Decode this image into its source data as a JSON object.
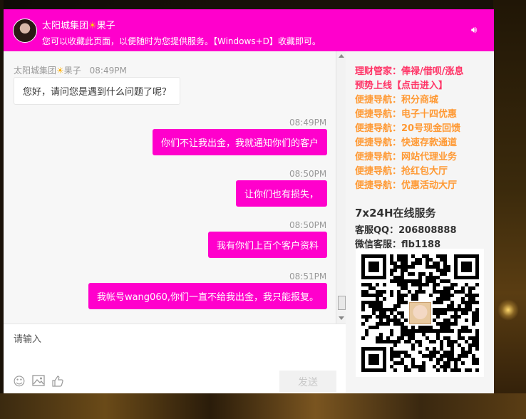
{
  "header": {
    "title_prefix": "太阳城集团",
    "title_suffix": "果子",
    "subtitle": "您可以收藏此页面，以便随时为您提供服务。【Windows+D】收藏即可。"
  },
  "messages": [
    {
      "side": "left",
      "sender_prefix": "太阳城集团",
      "sender_suffix": "果子",
      "time": "08:49PM",
      "text": "您好，请问您是遇到什么问题了呢？"
    },
    {
      "side": "right",
      "time": "08:49PM",
      "text": "你们不让我出金，我就通知你们的客户"
    },
    {
      "side": "right",
      "time": "08:50PM",
      "text": "让你们也有损失，"
    },
    {
      "side": "right",
      "time": "08:50PM",
      "text": "我有你们上百个客户资料"
    },
    {
      "side": "right",
      "time": "08:51PM",
      "text": "我帐号wang060,你们一直不给我出金，我只能报复。"
    }
  ],
  "input": {
    "placeholder": "请输入"
  },
  "toolbar": {
    "send_label": "发送"
  },
  "side": {
    "links": [
      {
        "text": "理财管家：俸禄/借呗/涨息",
        "color": "#ff3366"
      },
      {
        "text": "预势上线【点击进入】",
        "color": "#ff3366"
      },
      {
        "text": "便捷导航：积分商城",
        "color": "#ff9933"
      },
      {
        "text": "便捷导航：电子十四优惠",
        "color": "#ff9933"
      },
      {
        "text": "便捷导航：20号现金回馈",
        "color": "#ff9933"
      },
      {
        "text": "便捷导航：快速存款通道",
        "color": "#ff9933"
      },
      {
        "text": "便捷导航：网站代理业务",
        "color": "#ff9933"
      },
      {
        "text": "便捷导航：抢红包大厅",
        "color": "#ff9933"
      },
      {
        "text": "便捷导航：优惠活动大厅",
        "color": "#ff9933"
      }
    ],
    "service_title": "7x24H在线服务",
    "qq": "客服QQ：206808888",
    "wechat": "微信客服：flb1188"
  },
  "colors": {
    "accent": "#ff00cc"
  }
}
